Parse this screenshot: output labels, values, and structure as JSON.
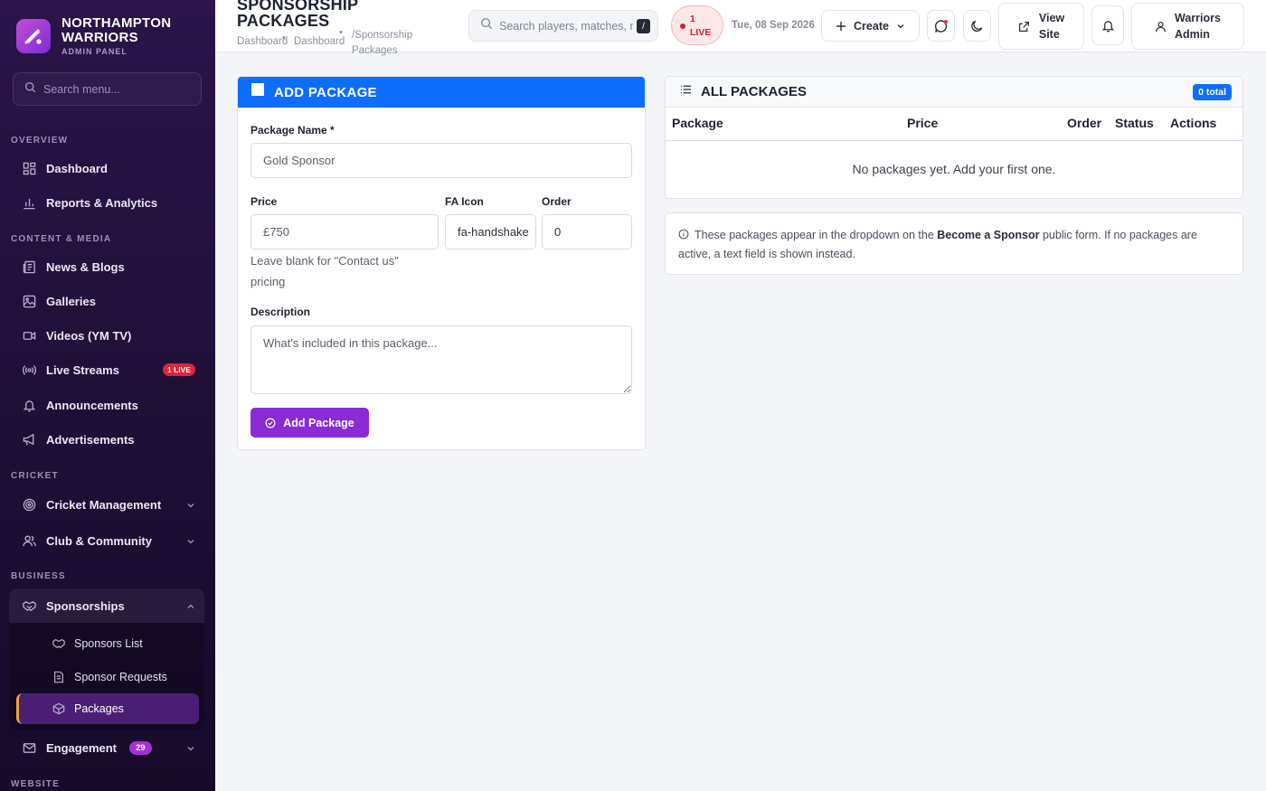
{
  "brand": {
    "name_line1": "NORTHAMPTON",
    "name_line2": "WARRIORS",
    "subtitle": "ADMIN PANEL"
  },
  "sidebar": {
    "search_placeholder": "Search menu...",
    "sections": {
      "overview": "OVERVIEW",
      "content": "CONTENT & MEDIA",
      "cricket": "CRICKET",
      "business": "BUSINESS",
      "website": "WEBSITE"
    },
    "items": {
      "dashboard": "Dashboard",
      "reports": "Reports & Analytics",
      "news": "News & Blogs",
      "galleries": "Galleries",
      "videos": "Videos (YM TV)",
      "live_streams": "Live Streams",
      "live_badge": "1 LIVE",
      "announcements": "Announcements",
      "advertisements": "Advertisements",
      "cricket_mgmt": "Cricket Management",
      "club": "Club & Community",
      "sponsorships": "Sponsorships",
      "sponsors_list": "Sponsors List",
      "sponsor_requests": "Sponsor Requests",
      "packages": "Packages",
      "engagement": "Engagement",
      "engagement_count": "29"
    }
  },
  "topbar": {
    "title_line1": "SPONSORSHIP",
    "title_line2": "PACKAGES",
    "crumb1": "Dashboard",
    "crumb2": "Dashboard",
    "crumb3_line1": "/Sponsorship",
    "crumb3_line2": "Packages",
    "search_placeholder": "Search players, matches, n",
    "search_kbd": "/",
    "live_count": "1",
    "live_label": "LIVE",
    "date": "Tue, 08 Sep 2026",
    "create_label": "Create",
    "view_site_line1": "View",
    "view_site_line2": "Site",
    "user_line1": "Warriors",
    "user_line2": "Admin"
  },
  "add_form": {
    "title": "ADD PACKAGE",
    "name_label": "Package Name *",
    "name_placeholder": "Gold Sponsor",
    "price_label": "Price",
    "price_placeholder": "£750",
    "price_help": "Leave blank for \"Contact us\" pricing",
    "icon_label": "FA Icon",
    "icon_value": "fa-handshake",
    "order_label": "Order",
    "order_value": "0",
    "desc_label": "Description",
    "desc_placeholder": "What's included in this package...",
    "submit_label": "Add Package"
  },
  "packages_table": {
    "title": "ALL PACKAGES",
    "total_badge": "0 total",
    "columns": [
      "Package",
      "Price",
      "Order",
      "Status",
      "Actions"
    ],
    "empty_text": "No packages yet. Add your first one."
  },
  "note": {
    "text_before": "These packages appear in the dropdown on the",
    "strong": "Become a Sponsor",
    "text_after": "public form. If no packages are active, a text field is shown instead."
  },
  "colors": {
    "primary": "#0d6efd",
    "accent": "#8a2bd6",
    "live": "#d1202f",
    "sidebar": "#1e0f36",
    "active_marker": "#f0a43a"
  }
}
